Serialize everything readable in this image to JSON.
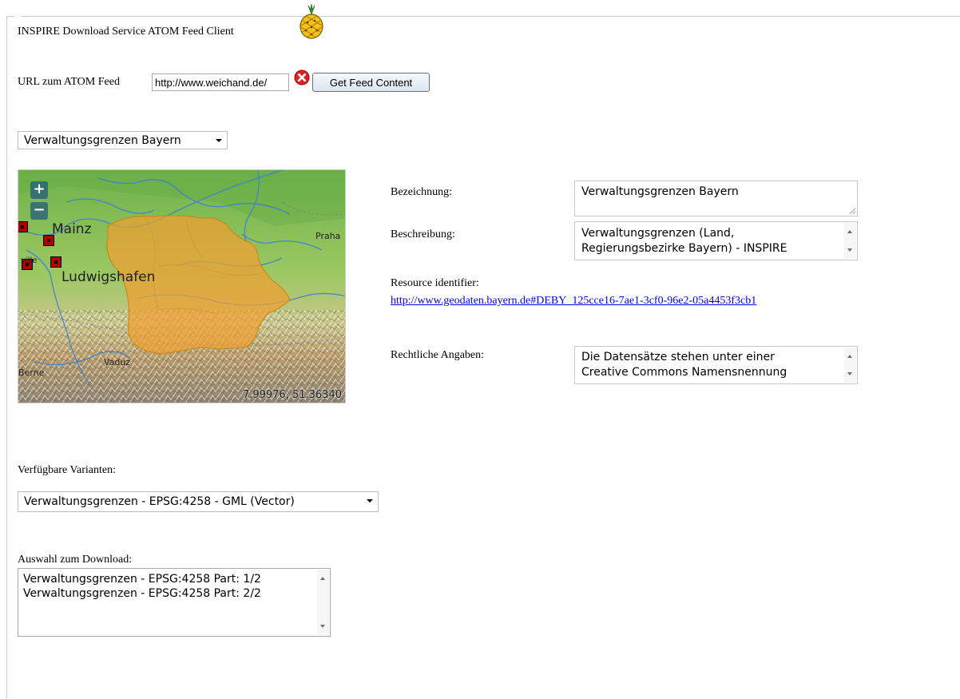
{
  "app": {
    "title": "INSPIRE Download Service ATOM Feed Client"
  },
  "feed": {
    "url_label": "URL zum ATOM Feed",
    "url_value": "http://www.weichand.de/",
    "get_button_label": "Get Feed Content"
  },
  "dataset_select": {
    "selected": "Verwaltungsgrenzen Bayern"
  },
  "map": {
    "zoom_in": "+",
    "zoom_out": "−",
    "coordinates": "7.99976, 51.36340",
    "cities": {
      "mainz": "Mainz",
      "ludwigshafen": "Ludwigshafen",
      "praha": "Praha",
      "vaduz": "Vaduz",
      "berne": "Berne",
      "ville": "ville"
    },
    "colors": {
      "terrain": "#8cbf5e",
      "highlight": "#f0a030",
      "rivers": "#3d7fd6"
    }
  },
  "details": {
    "bezeichnung_label": "Bezeichnung:",
    "bezeichnung_value": "Verwaltungsgrenzen Bayern",
    "beschreibung_label": "Beschreibung:",
    "beschreibung_line1": "Verwaltungsgrenzen (Land,",
    "beschreibung_line2": "Regierungsbezirke Bayern) - INSPIRE",
    "resource_label": "Resource identifier:",
    "resource_link": "http://www.geodaten.bayern.de#DEBY_125cce16-7ae1-3cf0-96e2-05a4453f3cb1",
    "rechtlich_label": "Rechtliche Angaben:",
    "rechtlich_line1": "Die Datensätze stehen unter einer",
    "rechtlich_line2": "Creative Commons Namensnennung"
  },
  "variants": {
    "label": "Verfügbare Varianten:",
    "selected": "Verwaltungsgrenzen - EPSG:4258 - GML (Vector)"
  },
  "download": {
    "label": "Auswahl zum Download:",
    "items": [
      "Verwaltungsgrenzen - EPSG:4258 Part: 1/2",
      "Verwaltungsgrenzen - EPSG:4258 Part: 2/2"
    ]
  }
}
